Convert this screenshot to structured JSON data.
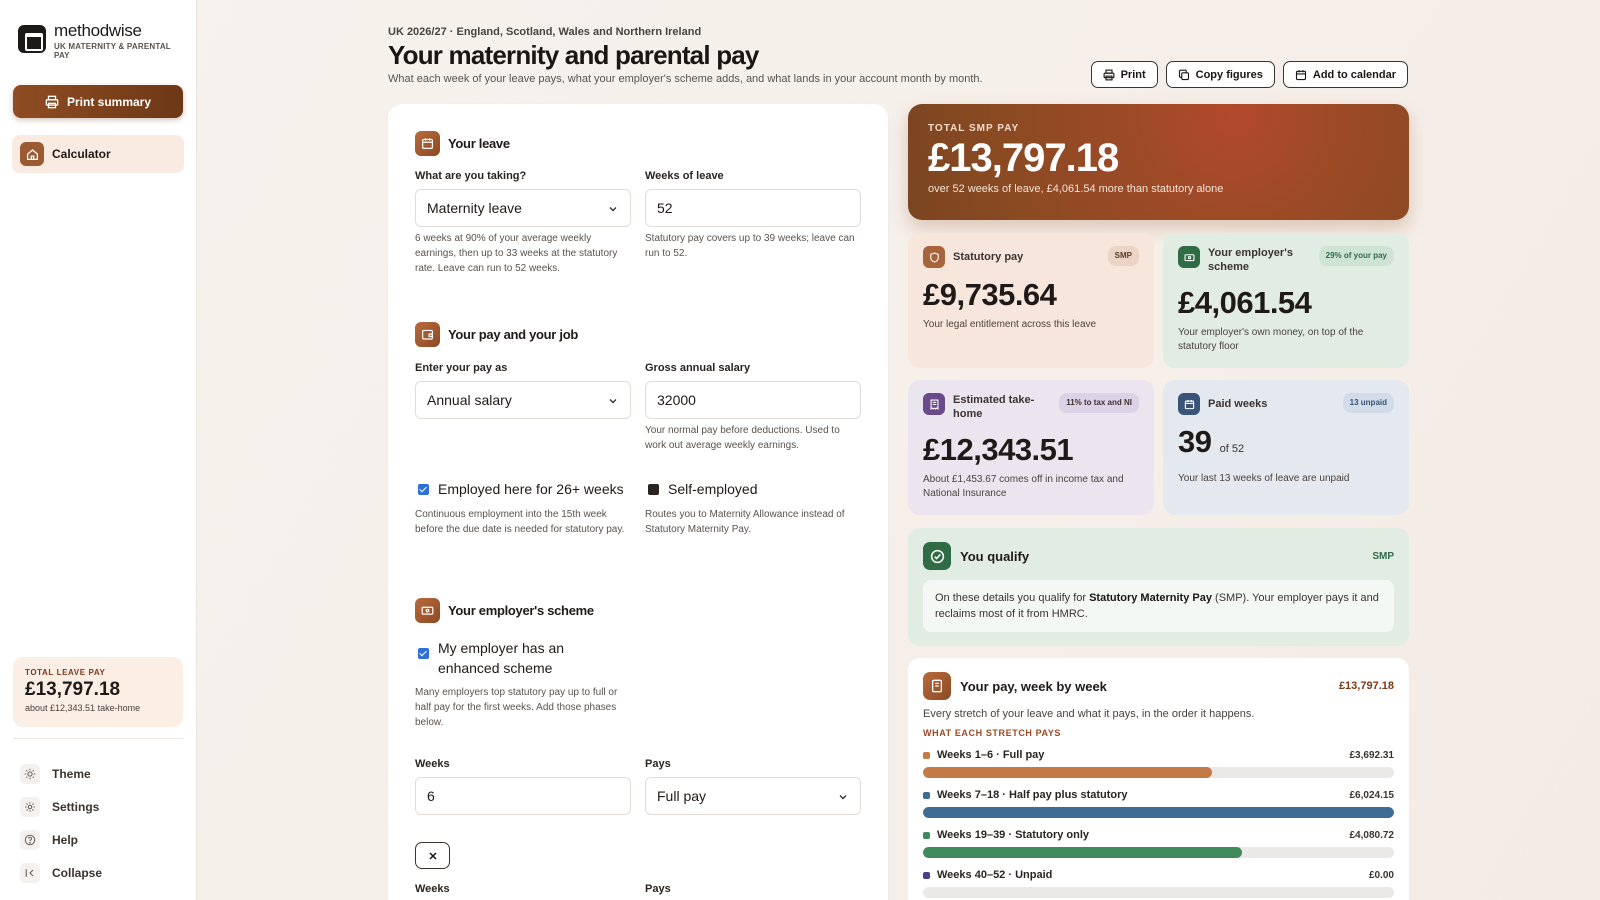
{
  "brand": {
    "name": "methodwise",
    "sub": "UK MATERNITY & PARENTAL PAY"
  },
  "sidebar": {
    "print_summary": "Print summary",
    "nav": [
      {
        "label": "Calculator",
        "icon": "home-icon",
        "active": true
      }
    ],
    "total_card": {
      "label": "TOTAL LEAVE PAY",
      "value": "£13,797.18",
      "sub": "about £12,343.51 take-home"
    },
    "menu": [
      {
        "label": "Theme",
        "icon": "sun-icon"
      },
      {
        "label": "Settings",
        "icon": "gear-icon"
      },
      {
        "label": "Help",
        "icon": "help-icon"
      },
      {
        "label": "Collapse",
        "icon": "collapse-icon"
      }
    ]
  },
  "header": {
    "crumb": "UK 2026/27 · England, Scotland, Wales and Northern Ireland",
    "title": "Your maternity and parental pay",
    "subtitle": "What each week of your leave pays, what your employer's scheme adds, and what lands in your account month by month.",
    "actions": {
      "print": "Print",
      "copy": "Copy figures",
      "calendar": "Add to calendar"
    }
  },
  "form": {
    "leave": {
      "title": "Your leave",
      "type_label": "What are you taking?",
      "type_value": "Maternity leave",
      "type_help": "6 weeks at 90% of your average weekly earnings, then up to 33 weeks at the statutory rate. Leave can run to 52 weeks.",
      "weeks_label": "Weeks of leave",
      "weeks_value": "52",
      "weeks_help": "Statutory pay covers up to 39 weeks; leave can run to 52."
    },
    "pay": {
      "title": "Your pay and your job",
      "mode_label": "Enter your pay as",
      "mode_value": "Annual salary",
      "salary_label": "Gross annual salary",
      "salary_value": "32000",
      "salary_help": "Your normal pay before deductions. Used to work out average weekly earnings.",
      "employed_label": "Employed here for 26+ weeks",
      "employed_help": "Continuous employment into the 15th week before the due date is needed for statutory pay.",
      "self_label": "Self-employed",
      "self_help": "Routes you to Maternity Allowance instead of Statutory Maternity Pay."
    },
    "scheme": {
      "title": "Your employer's scheme",
      "enhanced_label": "My employer has an enhanced scheme",
      "enhanced_help": "Many employers top statutory pay up to full or half pay for the first weeks. Add those phases below.",
      "weeks_label": "Weeks",
      "weeks_value": "6",
      "pays_label": "Pays",
      "pays_value": "Full pay",
      "weeks_label_2": "Weeks",
      "pays_label_2": "Pays"
    }
  },
  "summary": {
    "hero": {
      "label": "TOTAL SMP PAY",
      "value": "£13,797.18",
      "sub": "over 52 weeks of leave, £4,061.54 more than statutory alone"
    },
    "statutory": {
      "label": "Statutory pay",
      "badge": "SMP",
      "value": "£9,735.64",
      "desc": "Your legal entitlement across this leave"
    },
    "employer": {
      "label": "Your employer's scheme",
      "badge": "29% of your pay",
      "value": "£4,061.54",
      "desc": "Your employer's own money, on top of the statutory floor"
    },
    "takehome": {
      "label": "Estimated take-home",
      "badge": "11% to tax and NI",
      "value": "£12,343.51",
      "desc": "About £1,453.67 comes off in income tax and National Insurance"
    },
    "paid_weeks": {
      "label": "Paid weeks",
      "badge": "13 unpaid",
      "value": "39",
      "of": "of 52",
      "desc": "Your last 13 weeks of leave are unpaid"
    }
  },
  "qualify": {
    "title": "You qualify",
    "tag": "SMP",
    "text_a": "On these details you qualify for ",
    "text_b": "Statutory Maternity Pay",
    "text_c": " (SMP). Your employer pays it and reclaims most of it from HMRC."
  },
  "weekly": {
    "title": "Your pay, week by week",
    "total": "£13,797.18",
    "desc": "Every stretch of your leave and what it pays, in the order it happens.",
    "section_title": "WHAT EACH STRETCH PAYS",
    "phases": [
      {
        "label": "Weeks 1–6 · Full pay",
        "amount": "£3,692.31",
        "fraction": 0.613,
        "color": "#c47a45"
      },
      {
        "label": "Weeks 7–18 · Half pay plus statutory",
        "amount": "£6,024.15",
        "fraction": 1.0,
        "color": "#3f6c93"
      },
      {
        "label": "Weeks 19–39 · Statutory only",
        "amount": "£4,080.72",
        "fraction": 0.677,
        "color": "#3f8a5a"
      },
      {
        "label": "Weeks 40–52 · Unpaid",
        "amount": "£0.00",
        "fraction": 0,
        "color": "#4a3f8a"
      }
    ]
  }
}
